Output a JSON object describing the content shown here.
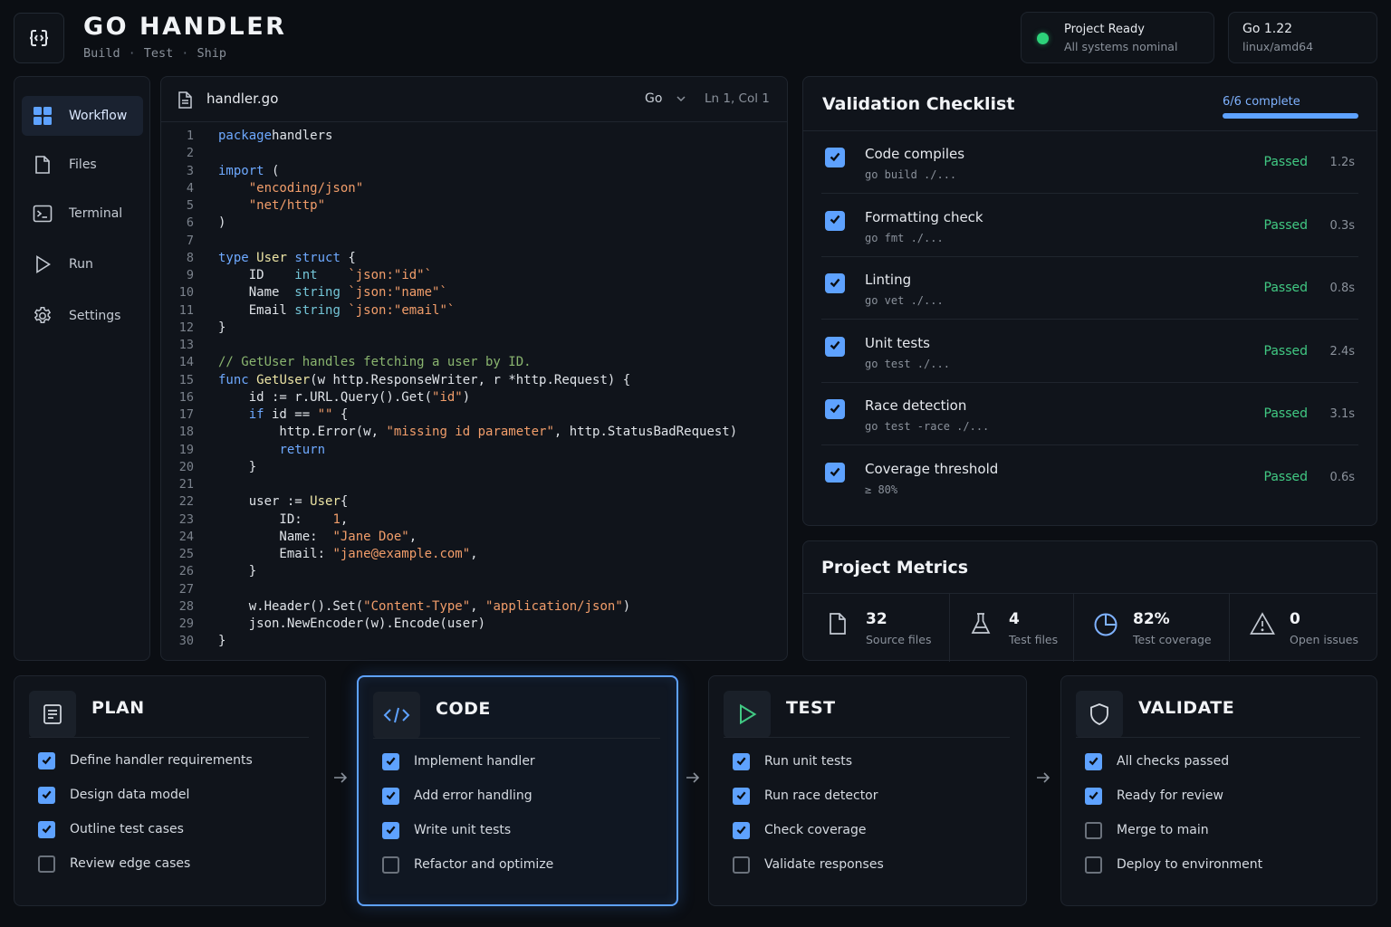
{
  "header": {
    "title": "GO HANDLER",
    "subtitle": [
      "Build",
      "Test",
      "Ship"
    ],
    "status": {
      "title": "Project Ready",
      "subtitle": "All systems nominal",
      "color": "#2dd27a"
    },
    "runtime": {
      "version": "Go 1.22",
      "platform": "linux/amd64"
    }
  },
  "sidebar": {
    "items": [
      {
        "label": "Workflow",
        "icon": "grid-icon",
        "active": true
      },
      {
        "label": "Files",
        "icon": "file-icon"
      },
      {
        "label": "Terminal",
        "icon": "terminal-icon"
      },
      {
        "label": "Run",
        "icon": "play-icon"
      },
      {
        "label": "Settings",
        "icon": "gear-icon"
      }
    ]
  },
  "editor": {
    "filename": "handler.go",
    "language": "Go",
    "cursor": "Ln 1, Col 1",
    "lines": [
      [
        [
          "kw",
          "package"
        ],
        [
          "",
          "handlers"
        ]
      ],
      [],
      [
        [
          "kw",
          "import"
        ],
        [
          "",
          " ("
        ]
      ],
      [
        [
          "",
          "    "
        ],
        [
          "st",
          "\"encoding/json\""
        ]
      ],
      [
        [
          "",
          "    "
        ],
        [
          "st",
          "\"net/http\""
        ]
      ],
      [
        [
          "",
          ")"
        ]
      ],
      [],
      [
        [
          "kw",
          "type"
        ],
        [
          "",
          " "
        ],
        [
          "fn",
          "User"
        ],
        [
          "",
          " "
        ],
        [
          "kw",
          "struct"
        ],
        [
          "",
          " {"
        ]
      ],
      [
        [
          "",
          "    ID    "
        ],
        [
          "ty",
          "int"
        ],
        [
          "",
          "    "
        ],
        [
          "st",
          "`json:\"id\"`"
        ]
      ],
      [
        [
          "",
          "    Name  "
        ],
        [
          "ty",
          "string"
        ],
        [
          "",
          " "
        ],
        [
          "st",
          "`json:\"name\"`"
        ]
      ],
      [
        [
          "",
          "    Email "
        ],
        [
          "ty",
          "string"
        ],
        [
          "",
          " "
        ],
        [
          "st",
          "`json:\"email\"`"
        ]
      ],
      [
        [
          "",
          "}"
        ]
      ],
      [],
      [
        [
          "cm",
          "// GetUser handles fetching a user by ID."
        ]
      ],
      [
        [
          "kw",
          "func"
        ],
        [
          "",
          " "
        ],
        [
          "fn",
          "GetUser"
        ],
        [
          "",
          "(w http.ResponseWriter, r *http.Request) {"
        ]
      ],
      [
        [
          "",
          "    id := r.URL.Query().Get("
        ],
        [
          "st",
          "\"id\""
        ],
        [
          "",
          ")"
        ]
      ],
      [
        [
          "",
          "    "
        ],
        [
          "kw",
          "if"
        ],
        [
          "",
          " id == "
        ],
        [
          "st",
          "\"\""
        ],
        [
          "",
          " {"
        ]
      ],
      [
        [
          "",
          "        http.Error(w, "
        ],
        [
          "st",
          "\"missing id parameter\""
        ],
        [
          "",
          ", http.StatusBadRequest)"
        ]
      ],
      [
        [
          "",
          "        "
        ],
        [
          "kw",
          "return"
        ]
      ],
      [
        [
          "",
          "    }"
        ]
      ],
      [],
      [
        [
          "",
          "    user := "
        ],
        [
          "fn",
          "User"
        ],
        [
          "",
          "{"
        ]
      ],
      [
        [
          "",
          "        ID:    "
        ],
        [
          "nm",
          "1"
        ],
        [
          "",
          ","
        ]
      ],
      [
        [
          "",
          "        Name:  "
        ],
        [
          "st",
          "\"Jane Doe\""
        ],
        [
          "",
          ","
        ]
      ],
      [
        [
          "",
          "        Email: "
        ],
        [
          "st",
          "\"jane@example.com\""
        ],
        [
          "",
          ","
        ]
      ],
      [
        [
          "",
          "    }"
        ]
      ],
      [],
      [
        [
          "",
          "    w.Header().Set("
        ],
        [
          "st",
          "\"Content-Type\""
        ],
        [
          "",
          ", "
        ],
        [
          "st",
          "\"application/json\""
        ],
        [
          "",
          ")"
        ]
      ],
      [
        [
          "",
          "    json.NewEncoder(w).Encode(user)"
        ]
      ],
      [
        [
          "",
          "}"
        ]
      ]
    ]
  },
  "checklist": {
    "title": "Validation Checklist",
    "progress_label": "6/6 complete",
    "progress": 1.0,
    "items": [
      {
        "name": "Code compiles",
        "command": "go build ./...",
        "status": "Passed",
        "time": "1.2s"
      },
      {
        "name": "Formatting check",
        "command": "go fmt ./...",
        "status": "Passed",
        "time": "0.3s"
      },
      {
        "name": "Linting",
        "command": "go vet ./...",
        "status": "Passed",
        "time": "0.8s"
      },
      {
        "name": "Unit tests",
        "command": "go test ./...",
        "status": "Passed",
        "time": "2.4s"
      },
      {
        "name": "Race detection",
        "command": "go test -race ./...",
        "status": "Passed",
        "time": "3.1s"
      },
      {
        "name": "Coverage threshold",
        "command": "≥ 80%",
        "status": "Passed",
        "time": "0.6s"
      }
    ]
  },
  "metrics": {
    "title": "Project Metrics",
    "items": [
      {
        "value": "32",
        "label": "Source files",
        "icon": "file-icon"
      },
      {
        "value": "4",
        "label": "Test files",
        "icon": "flask-icon"
      },
      {
        "value": "82%",
        "label": "Test coverage",
        "icon": "pie-icon"
      },
      {
        "value": "0",
        "label": "Open issues",
        "icon": "warning-icon"
      }
    ]
  },
  "workflow": [
    {
      "title": "PLAN",
      "icon": "document-icon",
      "items": [
        {
          "label": "Define handler requirements",
          "done": true
        },
        {
          "label": "Design data model",
          "done": true
        },
        {
          "label": "Outline test cases",
          "done": true
        },
        {
          "label": "Review edge cases",
          "done": false
        }
      ]
    },
    {
      "title": "CODE",
      "icon": "code-icon",
      "active": true,
      "items": [
        {
          "label": "Implement handler",
          "done": true
        },
        {
          "label": "Add error handling",
          "done": true
        },
        {
          "label": "Write unit tests",
          "done": true
        },
        {
          "label": "Refactor and optimize",
          "done": false
        }
      ]
    },
    {
      "title": "TEST",
      "icon": "play-icon",
      "items": [
        {
          "label": "Run unit tests",
          "done": true
        },
        {
          "label": "Run race detector",
          "done": true
        },
        {
          "label": "Check coverage",
          "done": true
        },
        {
          "label": "Validate responses",
          "done": false
        }
      ]
    },
    {
      "title": "VALIDATE",
      "icon": "shield-icon",
      "items": [
        {
          "label": "All checks passed",
          "done": true
        },
        {
          "label": "Ready for review",
          "done": true
        },
        {
          "label": "Merge to main",
          "done": false
        },
        {
          "label": "Deploy to environment",
          "done": false
        }
      ]
    }
  ],
  "colors": {
    "accent": "#5ea2ff",
    "passed": "#41c983",
    "background": "#0b0e13"
  }
}
